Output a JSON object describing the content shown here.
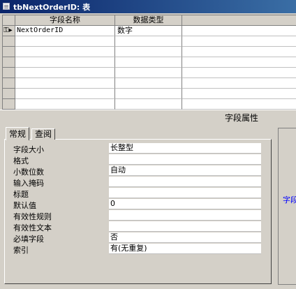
{
  "window": {
    "title": "tbNextOrderID: 表"
  },
  "design_grid": {
    "columns": [
      "字段名称",
      "数据类型",
      ""
    ],
    "rows": [
      {
        "field_name": "NextOrderID",
        "data_type": "数字",
        "description": ""
      }
    ]
  },
  "field_properties": {
    "heading": "字段属性",
    "tabs": [
      "常规",
      "查阅"
    ],
    "active_tab": "常规",
    "rows": [
      {
        "label": "字段大小",
        "value": "长整型"
      },
      {
        "label": "格式",
        "value": ""
      },
      {
        "label": "小数位数",
        "value": "自动"
      },
      {
        "label": "输入掩码",
        "value": ""
      },
      {
        "label": "标题",
        "value": ""
      },
      {
        "label": "默认值",
        "value": "0"
      },
      {
        "label": "有效性规则",
        "value": ""
      },
      {
        "label": "有效性文本",
        "value": ""
      },
      {
        "label": "必填字段",
        "value": "否"
      },
      {
        "label": "索引",
        "value": "有(无重复)"
      }
    ],
    "help_text": "字段"
  },
  "icons": {
    "title": "table-icon",
    "row_selector": "primary-key-icon"
  },
  "colors": {
    "titlebar_start": "#0a246a",
    "titlebar_end": "#3a6ea5",
    "help_text": "#0000ff"
  }
}
